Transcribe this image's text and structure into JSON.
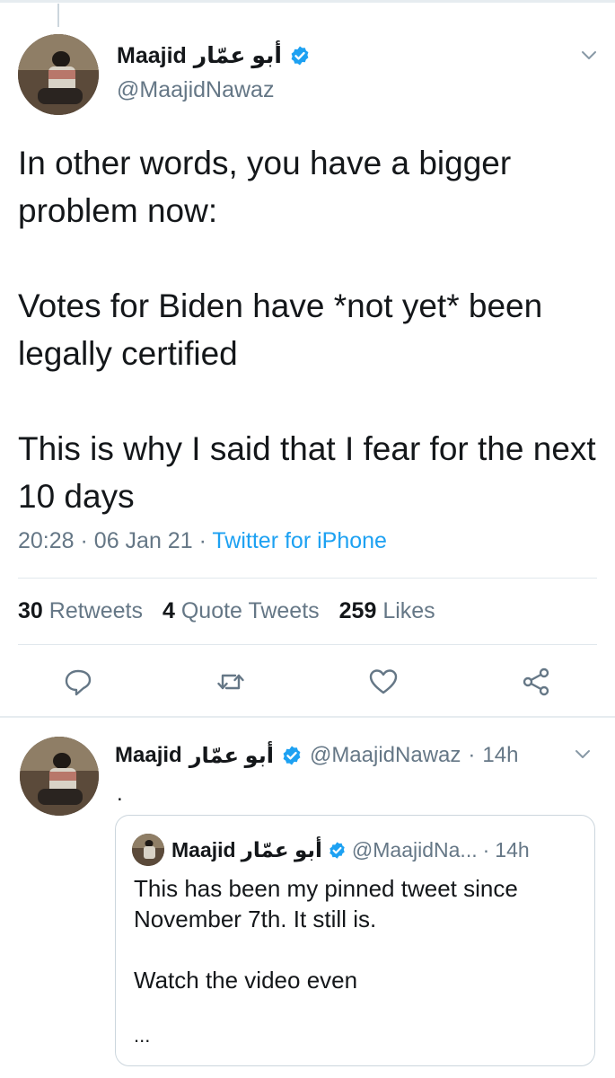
{
  "main_tweet": {
    "display_name": "Maajid",
    "display_name_arabic": "أبو عمّار",
    "handle": "@MaajidNawaz",
    "text": "In other words, you have a bigger problem now:\n\nVotes for Biden have *not yet* been legally certified\n\nThis is why I said that I fear for the next 10 days",
    "time": "20:28",
    "date": "06 Jan 21",
    "separator": "·",
    "source": "Twitter for iPhone",
    "stats": {
      "retweets_count": "30",
      "retweets_label": "Retweets",
      "quotes_count": "4",
      "quotes_label": "Quote Tweets",
      "likes_count": "259",
      "likes_label": "Likes"
    }
  },
  "reply_tweet": {
    "display_name": "Maajid",
    "display_name_arabic": "أبو عمّار",
    "handle": "@MaajidNawaz",
    "separator": "·",
    "age": "14h",
    "text": ".",
    "quoted": {
      "display_name": "Maajid",
      "display_name_arabic": "أبو عمّار",
      "handle": "@MaajidNa...",
      "separator": "·",
      "age": "14h",
      "text": "This has been my pinned tweet since November 7th. It still is.\n\nWatch the video even",
      "ellipsis": "..."
    }
  },
  "icons": {
    "verified": "verified-badge-icon",
    "reply": "reply-icon",
    "retweet": "retweet-icon",
    "like": "heart-icon",
    "share": "share-icon",
    "more": "chevron-down-icon"
  },
  "colors": {
    "accent": "#1da1f2",
    "text": "#14171a",
    "secondary": "#657786",
    "divider": "#e1e8ed"
  }
}
